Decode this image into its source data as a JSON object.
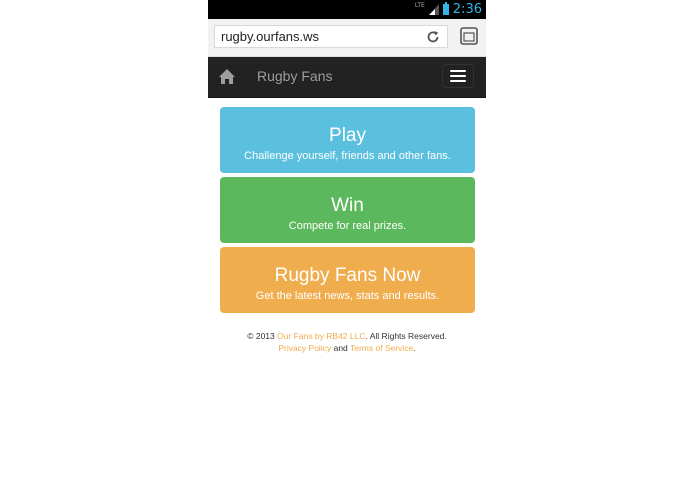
{
  "status": {
    "network": "LTE",
    "time": "2:36"
  },
  "browser": {
    "url": "rugby.ourfans.ws"
  },
  "navbar": {
    "brand": "Rugby Fans"
  },
  "cards": [
    {
      "title": "Play",
      "subtitle": "Challenge yourself, friends and other fans.",
      "color": "#5bc0de"
    },
    {
      "title": "Win",
      "subtitle": "Compete for real prizes.",
      "color": "#5cb85c"
    },
    {
      "title": "Rugby Fans Now",
      "subtitle": "Get the latest news, stats and results.",
      "color": "#f0ad4e"
    }
  ],
  "footer": {
    "copyright": "© 2013",
    "company_link": "Our Fans by RB42 LLC",
    "rights": ". All Rights Reserved.",
    "privacy_link": "Privacy Policy",
    "and": "and",
    "terms_link": "Terms of Service",
    "period": "."
  }
}
